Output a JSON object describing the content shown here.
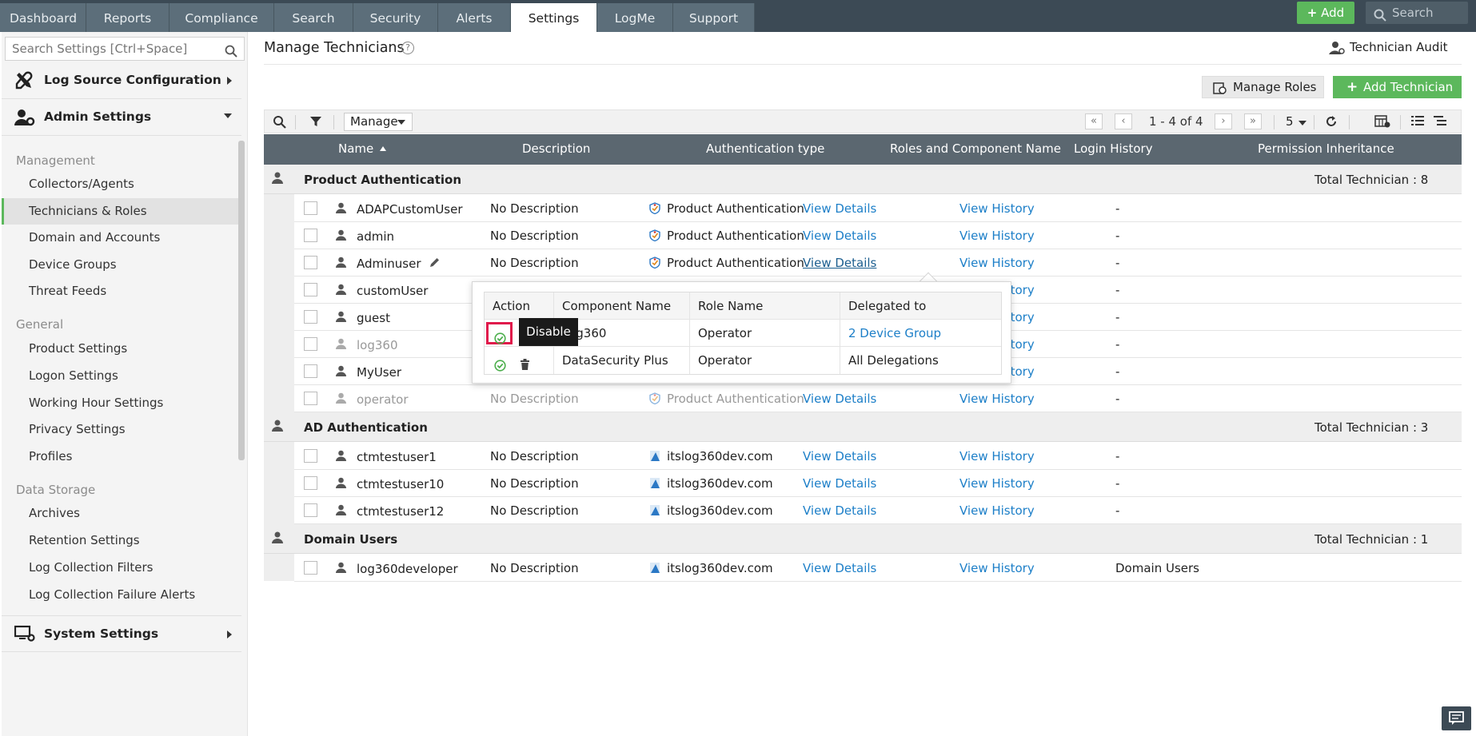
{
  "topnav": {
    "tabs": [
      {
        "label": "Dashboard"
      },
      {
        "label": "Reports"
      },
      {
        "label": "Compliance"
      },
      {
        "label": "Search"
      },
      {
        "label": "Security"
      },
      {
        "label": "Alerts"
      },
      {
        "label": "Settings",
        "active": true
      },
      {
        "label": "LogMe"
      },
      {
        "label": "Support"
      }
    ],
    "add_label": "Add",
    "search_placeholder": "Search"
  },
  "sidebar": {
    "search_placeholder": "Search Settings [Ctrl+Space]",
    "sections": {
      "log_source": "Log Source Configuration",
      "admin": "Admin Settings",
      "system": "System Settings"
    },
    "groups": {
      "management": "Management",
      "general": "General",
      "data_storage": "Data Storage"
    },
    "items": {
      "collectors": "Collectors/Agents",
      "technicians": "Technicians & Roles",
      "domain": "Domain and Accounts",
      "device_groups": "Device Groups",
      "threat_feeds": "Threat Feeds",
      "product_settings": "Product Settings",
      "logon_settings": "Logon Settings",
      "working_hour": "Working Hour Settings",
      "privacy": "Privacy Settings",
      "profiles": "Profiles",
      "archives": "Archives",
      "retention": "Retention Settings",
      "collection_filters": "Log Collection Filters",
      "collection_failure": "Log Collection Failure Alerts"
    }
  },
  "main": {
    "title": "Manage Technicians",
    "technician_audit": "Technician Audit",
    "manage_roles": "Manage Roles",
    "add_technician": "Add Technician"
  },
  "toolbar": {
    "manage_label": "Manage",
    "page_range": "1 - 4 of 4",
    "page_size": "5"
  },
  "table": {
    "headers": {
      "name": "Name",
      "description": "Description",
      "auth": "Authentication type",
      "roles": "Roles and Component Name",
      "login": "Login History",
      "perm": "Permission Inheritance"
    },
    "groups": [
      {
        "name": "Product Authentication",
        "total": "Total Technician : 8",
        "rows": [
          {
            "name": "ADAPCustomUser",
            "desc": "No Description",
            "auth": "Product Authentication",
            "roles": "View Details",
            "history": "View History",
            "perm": "-"
          },
          {
            "name": "admin",
            "desc": "No Description",
            "auth": "Product Authentication",
            "roles": "View Details",
            "history": "View History",
            "perm": "-"
          },
          {
            "name": "Adminuser",
            "desc": "No Description",
            "auth": "Product Authentication",
            "roles": "View Details",
            "history": "View History",
            "perm": "-"
          },
          {
            "name": "customUser",
            "history": "View History",
            "perm": "-"
          },
          {
            "name": "guest",
            "history": "View History",
            "perm": "-"
          },
          {
            "name": "log360",
            "history": "View History",
            "perm": "-"
          },
          {
            "name": "MyUser",
            "history": "View History",
            "perm": "-"
          },
          {
            "name": "operator",
            "desc": "No Description",
            "auth": "Product Authentication",
            "roles": "View Details",
            "history": "View History",
            "perm": "-"
          }
        ]
      },
      {
        "name": "AD Authentication",
        "total": "Total Technician : 3",
        "rows": [
          {
            "name": "ctmtestuser1",
            "desc": "No Description",
            "auth": "itslog360dev.com",
            "roles": "View Details",
            "history": "View History",
            "perm": "-"
          },
          {
            "name": "ctmtestuser10",
            "desc": "No Description",
            "auth": "itslog360dev.com",
            "roles": "View Details",
            "history": "View History",
            "perm": "-"
          },
          {
            "name": "ctmtestuser12",
            "desc": "No Description",
            "auth": "itslog360dev.com",
            "roles": "View Details",
            "history": "View History",
            "perm": "-"
          }
        ]
      },
      {
        "name": "Domain Users",
        "total": "Total Technician : 1",
        "rows": [
          {
            "name": "log360developer",
            "desc": "No Description",
            "auth": "itslog360dev.com",
            "roles": "View Details",
            "history": "View History",
            "perm": "Domain Users"
          }
        ]
      }
    ]
  },
  "popup": {
    "headers": {
      "action": "Action",
      "component": "Component Name",
      "role": "Role Name",
      "delegated": "Delegated to"
    },
    "rows": [
      {
        "component": "Log360",
        "role": "Operator",
        "delegated": "2 Device Group"
      },
      {
        "component": "DataSecurity Plus",
        "role": "Operator",
        "delegated": "All Delegations"
      }
    ],
    "tooltip": "Disable"
  },
  "colors": {
    "accent_green": "#5cb85c",
    "link_blue": "#1d7fc8",
    "nav_dark": "#3c4a55",
    "highlight_red": "#e0194b"
  }
}
